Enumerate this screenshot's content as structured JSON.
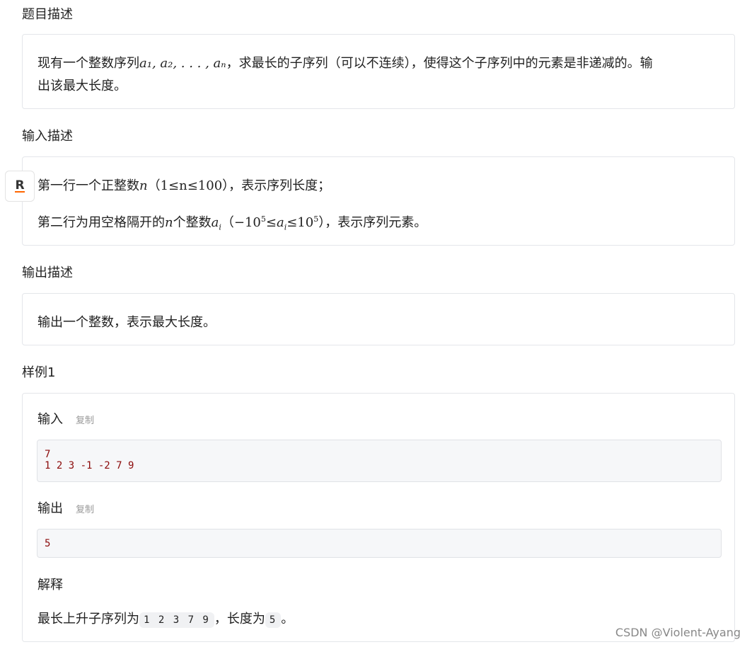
{
  "sections": {
    "desc_title": "题目描述",
    "desc_text_a": "现有一个整数序列",
    "desc_math": "a₁, a₂, . . . , aₙ",
    "desc_text_b": "，求最长的子序列（可以不连续），使得这个子序列中的元素是非递减的。输",
    "desc_text_c": "出该最大长度。",
    "input_title": "输入描述",
    "input_line1_a": "第一行一个正整数",
    "input_line1_m": "n",
    "input_line1_b": "（",
    "input_line1_range": "1≤n≤100",
    "input_line1_c": "），表示序列长度；",
    "input_line2_a": "第二行为用空格隔开的",
    "input_line2_m": "n",
    "input_line2_b": "个整数",
    "input_line2_ai": "a",
    "input_line2_sub": "i",
    "input_line2_c": "（",
    "input_line2_range_a": "−10",
    "input_line2_sup1": "5",
    "input_line2_range_b": "≤a",
    "input_line2_sub2": "i",
    "input_line2_range_c": "≤10",
    "input_line2_sup2": "5",
    "input_line2_d": "），表示序列元素。",
    "output_title": "输出描述",
    "output_text": "输出一个整数，表示最大长度。",
    "sample_title": "样例1"
  },
  "sample": {
    "input_label": "输入",
    "copy_label": "复制",
    "input_code": "7\n1 2 3 -1 -2 7 9",
    "output_label": "输出",
    "output_code": "5",
    "explain_label": "解释",
    "explain_a": "最长上升子序列为",
    "explain_chip1": "1 2 3 7 9",
    "explain_b": "，长度为",
    "explain_chip2": "5",
    "explain_c": "。"
  },
  "side_button": "R",
  "watermark": "CSDN @Violent-Ayang"
}
